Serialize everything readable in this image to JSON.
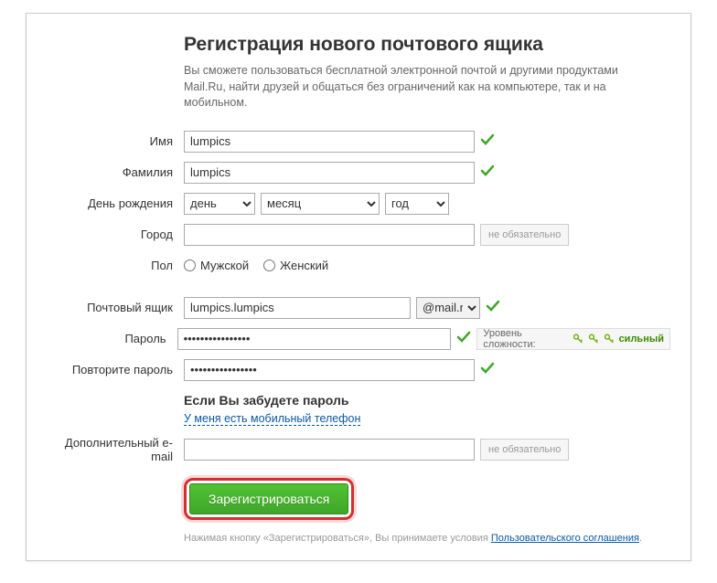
{
  "header": {
    "title": "Регистрация нового почтового ящика",
    "subtitle": "Вы сможете пользоваться бесплатной электронной почтой и другими продуктами Mail.Ru, найти друзей и общаться без ограничений как на компьютере, так и на мобильном."
  },
  "labels": {
    "firstName": "Имя",
    "lastName": "Фамилия",
    "birthday": "День рождения",
    "city": "Город",
    "gender": "Пол",
    "mailbox": "Почтовый ящик",
    "password": "Пароль",
    "confirmPassword": "Повторите пароль",
    "altEmail": "Дополнительный e-mail",
    "optional": "не обязательно"
  },
  "values": {
    "firstName": "lumpics",
    "lastName": "lumpics",
    "day": "день",
    "month": "месяц",
    "year": "год",
    "city": "",
    "male": "Мужской",
    "female": "Женский",
    "mailboxName": "lumpics.lumpics",
    "mailboxDomain": "@mail.ru",
    "password": "••••••••••••••••",
    "confirmPassword": "••••••••••••••••",
    "altEmail": ""
  },
  "strength": {
    "label": "Уровень сложности:",
    "value": "сильный"
  },
  "forgot": {
    "title": "Если Вы забудете пароль",
    "link": "У меня есть мобильный телефон"
  },
  "submit": "Зарегистрироваться",
  "terms": {
    "prefix": "Нажимая кнопку «Зарегистрироваться», Вы принимаете условия ",
    "link": "Пользовательского соглашения",
    "suffix": "."
  }
}
